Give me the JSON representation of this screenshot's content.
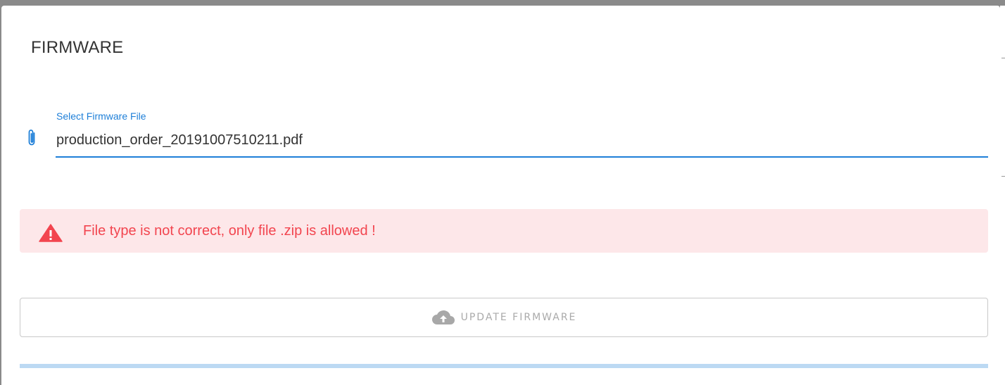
{
  "dialog": {
    "title": "FIRMWARE"
  },
  "file_input": {
    "label": "Select Firmware File",
    "value": "production_order_20191007510211.pdf",
    "icon": "paperclip-icon",
    "accent_color": "#1e7fd8"
  },
  "alert": {
    "icon": "warning-triangle-icon",
    "message": "File type is not correct, only file .zip is allowed !",
    "text_color": "#f2454f",
    "background_color": "#fde7e9"
  },
  "update_button": {
    "icon": "cloud-upload-icon",
    "label": "UPDATE FIRMWARE",
    "disabled": true
  },
  "progress": {
    "value_percent": 0
  }
}
